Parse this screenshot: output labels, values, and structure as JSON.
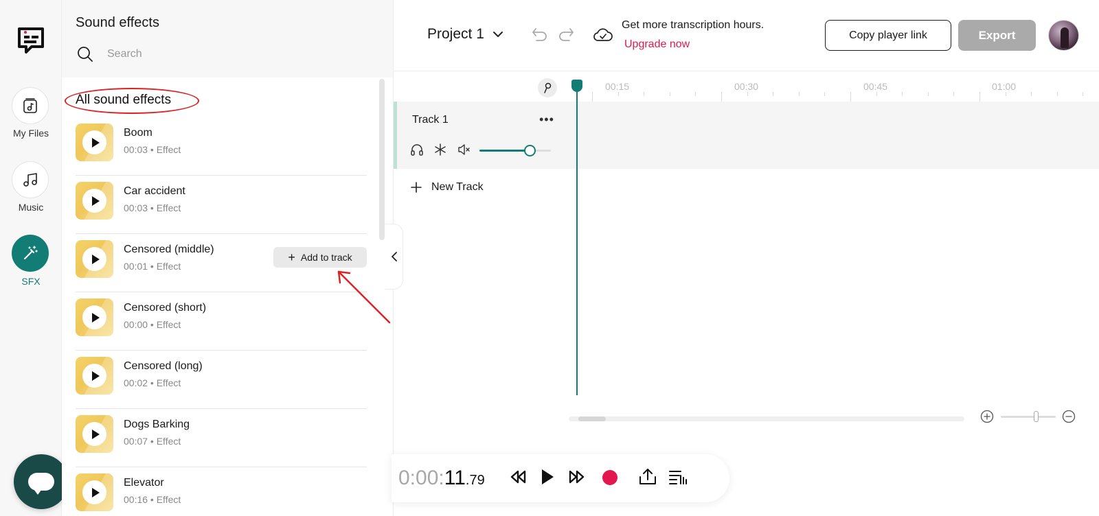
{
  "rail": {
    "items": [
      {
        "label": "My Files",
        "icon": "music-file-icon"
      },
      {
        "label": "Music",
        "icon": "music-note-icon"
      },
      {
        "label": "SFX",
        "icon": "magic-wand-icon",
        "active": true
      }
    ]
  },
  "panel": {
    "title": "Sound effects",
    "search_placeholder": "Search",
    "section_title": "All sound effects",
    "items": [
      {
        "name": "Boom",
        "meta": "00:03 • Effect"
      },
      {
        "name": "Car accident",
        "meta": "00:03 • Effect"
      },
      {
        "name": "Censored (middle)",
        "meta": "00:01 • Effect",
        "hovered": true
      },
      {
        "name": "Censored (short)",
        "meta": "00:00 • Effect"
      },
      {
        "name": "Censored (long)",
        "meta": "00:02 • Effect"
      },
      {
        "name": "Dogs Barking",
        "meta": "00:07 • Effect"
      },
      {
        "name": "Elevator",
        "meta": "00:16 • Effect"
      }
    ],
    "add_to_track_label": "Add to track"
  },
  "topbar": {
    "project_name": "Project 1",
    "promo_text": "Get more transcription hours.",
    "upgrade_link": "Upgrade now",
    "copy_player_link": "Copy player link",
    "export": "Export"
  },
  "timeline": {
    "ticks": [
      "00:15",
      "00:30",
      "00:45",
      "01:00"
    ],
    "track_name": "Track 1",
    "track_more": "•••",
    "volume": 0.7,
    "new_track": "New Track"
  },
  "transport": {
    "time_dim": "0:00:",
    "time_main": "11",
    "time_fraction": ".79"
  },
  "colors": {
    "accent": "#127d74",
    "record": "#e3184f",
    "upgrade": "#e3184f",
    "annotation": "#e02020"
  }
}
